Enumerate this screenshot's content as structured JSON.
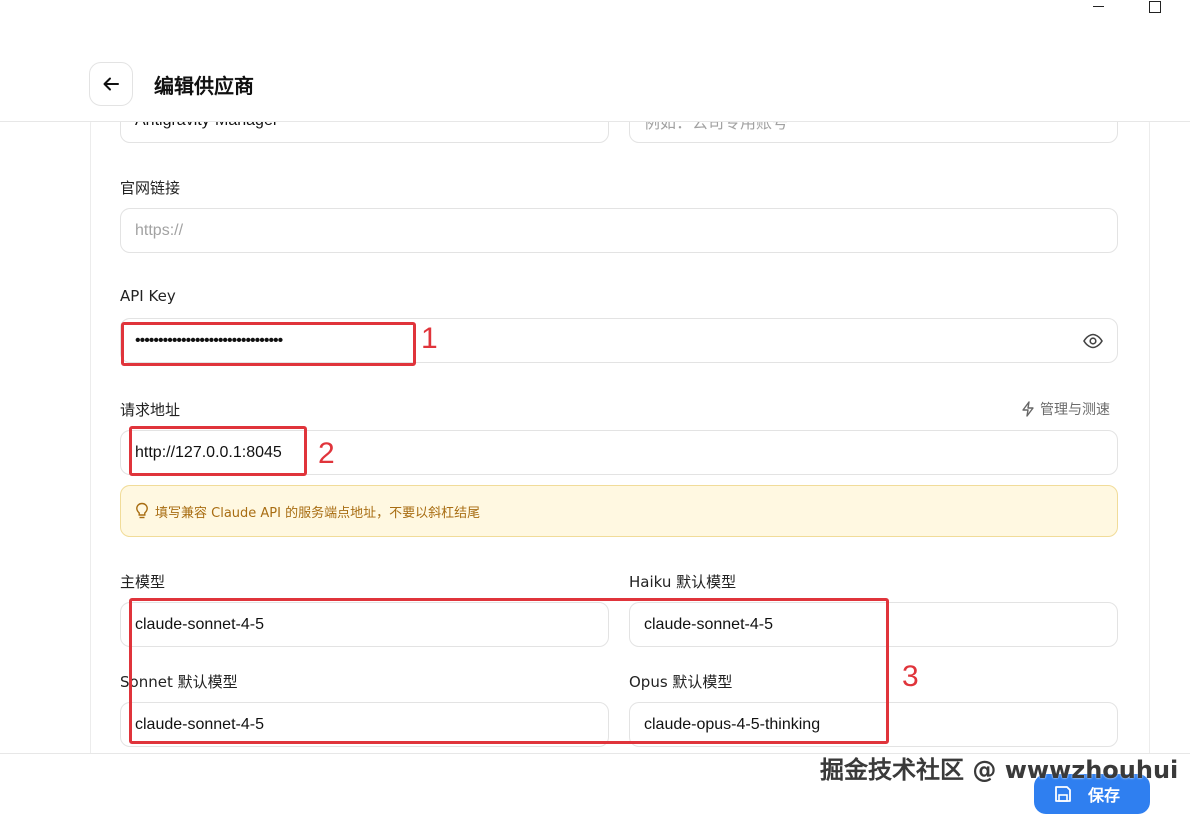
{
  "header": {
    "title": "编辑供应商"
  },
  "fields": {
    "name_value": "Antigravity-Manager",
    "note_placeholder": "例如：公司专用账号",
    "website_label": "官网链接",
    "website_placeholder": "https://",
    "api_key_label": "API Key",
    "api_key_value": "••••••••••••••••••••••••••••••••",
    "endpoint_label": "请求地址",
    "endpoint_value": "http://127.0.0.1:8045",
    "manage_link": "管理与测速",
    "hint": "填写兼容 Claude API 的服务端点地址，不要以斜杠结尾",
    "main_model_label": "主模型",
    "main_model_value": "claude-sonnet-4-5",
    "haiku_label": "Haiku 默认模型",
    "haiku_value": "claude-sonnet-4-5",
    "sonnet_label": "Sonnet 默认模型",
    "sonnet_value": "claude-sonnet-4-5",
    "opus_label": "Opus 默认模型",
    "opus_value": "claude-opus-4-5-thinking"
  },
  "annotations": [
    "1",
    "2",
    "3"
  ],
  "footer": {
    "save_label": "保存"
  },
  "watermark": "掘金技术社区 @ wwwzhouhui",
  "colors": {
    "accent": "#2f7ff0",
    "annotation": "#e0343b",
    "hint_bg": "#fff8e1",
    "hint_text": "#a86d12"
  },
  "icons": [
    "app-logo-icon",
    "minimize-icon",
    "maximize-icon",
    "back-arrow-icon",
    "eye-icon",
    "lightning-icon",
    "bulb-icon",
    "save-icon"
  ]
}
